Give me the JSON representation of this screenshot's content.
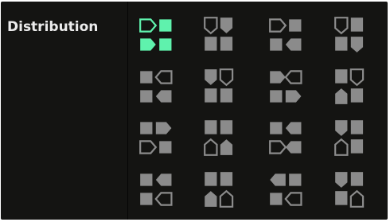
{
  "section": {
    "label": "Distribution"
  },
  "colors": {
    "panel_bg": "#141412",
    "icon_gray": "#8b8b8b",
    "icon_selected": "#5ff2ad",
    "label_text": "#ececec"
  },
  "distribution_options": [
    {
      "id": "h-right-both",
      "icon": "h-right-both",
      "selected": true
    },
    {
      "id": "v-down-left",
      "icon": "v-down-left",
      "selected": false
    },
    {
      "id": "h-right-top",
      "icon": "h-right-top",
      "selected": false
    },
    {
      "id": "v-down-right",
      "icon": "v-down-right",
      "selected": false
    },
    {
      "id": "h-left-both",
      "icon": "h-left-both",
      "selected": false
    },
    {
      "id": "v-down-both",
      "icon": "v-down-both",
      "selected": false
    },
    {
      "id": "h-left-top",
      "icon": "h-left-top",
      "selected": false
    },
    {
      "id": "v-down-right-2",
      "icon": "v-down-right-2",
      "selected": false
    },
    {
      "id": "h-right-bottom",
      "icon": "h-right-bottom",
      "selected": false
    },
    {
      "id": "v-up-both",
      "icon": "v-up-both",
      "selected": false
    },
    {
      "id": "h-right-bottom-2",
      "icon": "h-right-bottom-2",
      "selected": false
    },
    {
      "id": "v-mixed",
      "icon": "v-mixed",
      "selected": false
    },
    {
      "id": "h-left-bottom",
      "icon": "h-left-bottom",
      "selected": false
    },
    {
      "id": "v-up-left",
      "icon": "v-up-left",
      "selected": false
    },
    {
      "id": "h-left-bottom-2",
      "icon": "h-left-bottom-2",
      "selected": false
    },
    {
      "id": "v-up-right",
      "icon": "v-up-right",
      "selected": false
    }
  ]
}
